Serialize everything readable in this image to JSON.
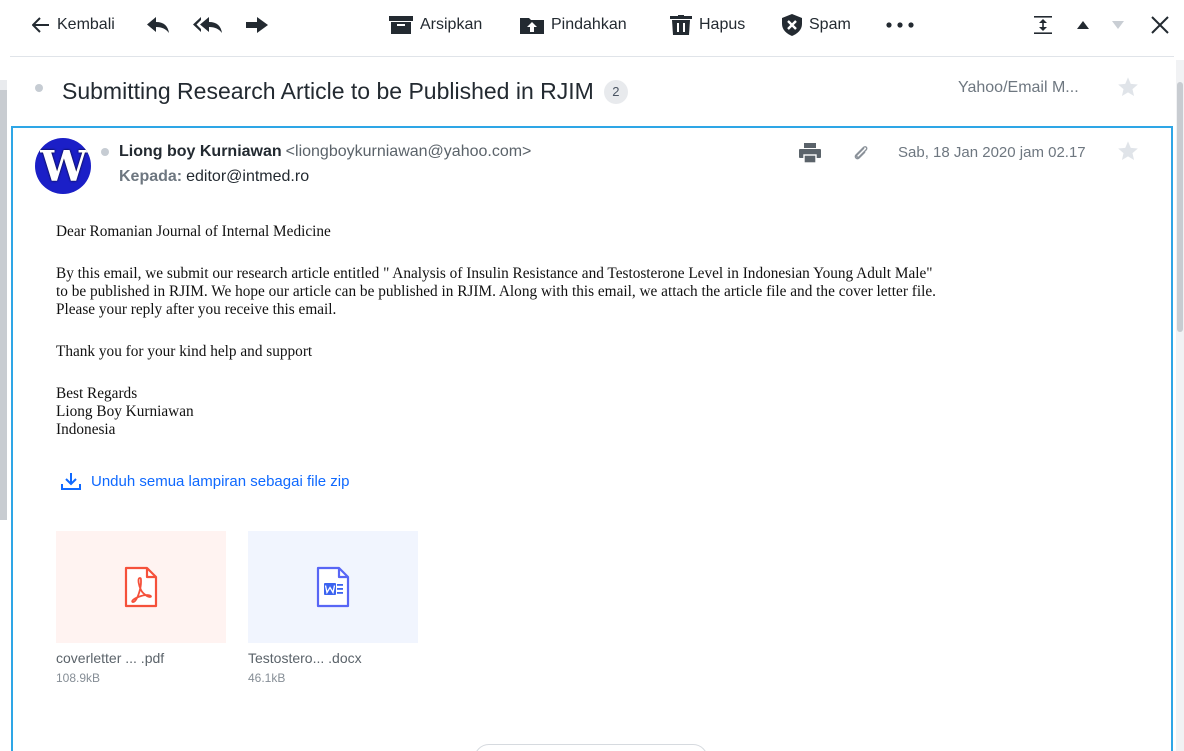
{
  "toolbar": {
    "back_label": "Kembali",
    "archive_label": "Arsipkan",
    "move_label": "Pindahkan",
    "delete_label": "Hapus",
    "spam_label": "Spam"
  },
  "subject": {
    "title": "Submitting Research Article to be Published in RJIM",
    "thread_count": "2",
    "folder": "Yahoo/Email M..."
  },
  "message": {
    "avatar_letter": "W",
    "sender_name": "Liong boy Kurniawan",
    "sender_email": "<liongboykurniawan@yahoo.com>",
    "recipient_label": "Kepada:",
    "recipient": "editor@intmed.ro",
    "date": "Sab, 18 Jan 2020 jam 02.17",
    "body": {
      "greeting": "Dear Romanian Journal of Internal Medicine",
      "p1_line1": "By this email, we submit our research article entitled \" Analysis of Insulin Resistance and Testosterone Level in Indonesian Young Adult Male\"",
      "p1_line2": "to be published in RJIM. We hope our article can be published in RJIM. Along with this email, we attach the article file and the cover letter file.",
      "p1_line3": "Please your reply after you receive this email.",
      "thanks": "Thank you for your kind help and support",
      "sign1": "Best Regards",
      "sign2": "Liong Boy Kurniawan",
      "sign3": "Indonesia"
    },
    "download_all_label": "Unduh semua lampiran sebagai file zip"
  },
  "attachments": [
    {
      "name": "coverletter ... .pdf",
      "size": "108.9kB",
      "kind": "pdf-icon",
      "bg": "#fff3f1",
      "color": "#f5513b"
    },
    {
      "name": "Testostero... .docx",
      "size": "46.1kB",
      "kind": "word-doc-icon",
      "bg": "#f1f5fe",
      "color": "#4a63ff"
    }
  ],
  "colors": {
    "accent": "#2ea6e6",
    "link": "#0f69ff",
    "avatar": "#1b1fc7"
  }
}
